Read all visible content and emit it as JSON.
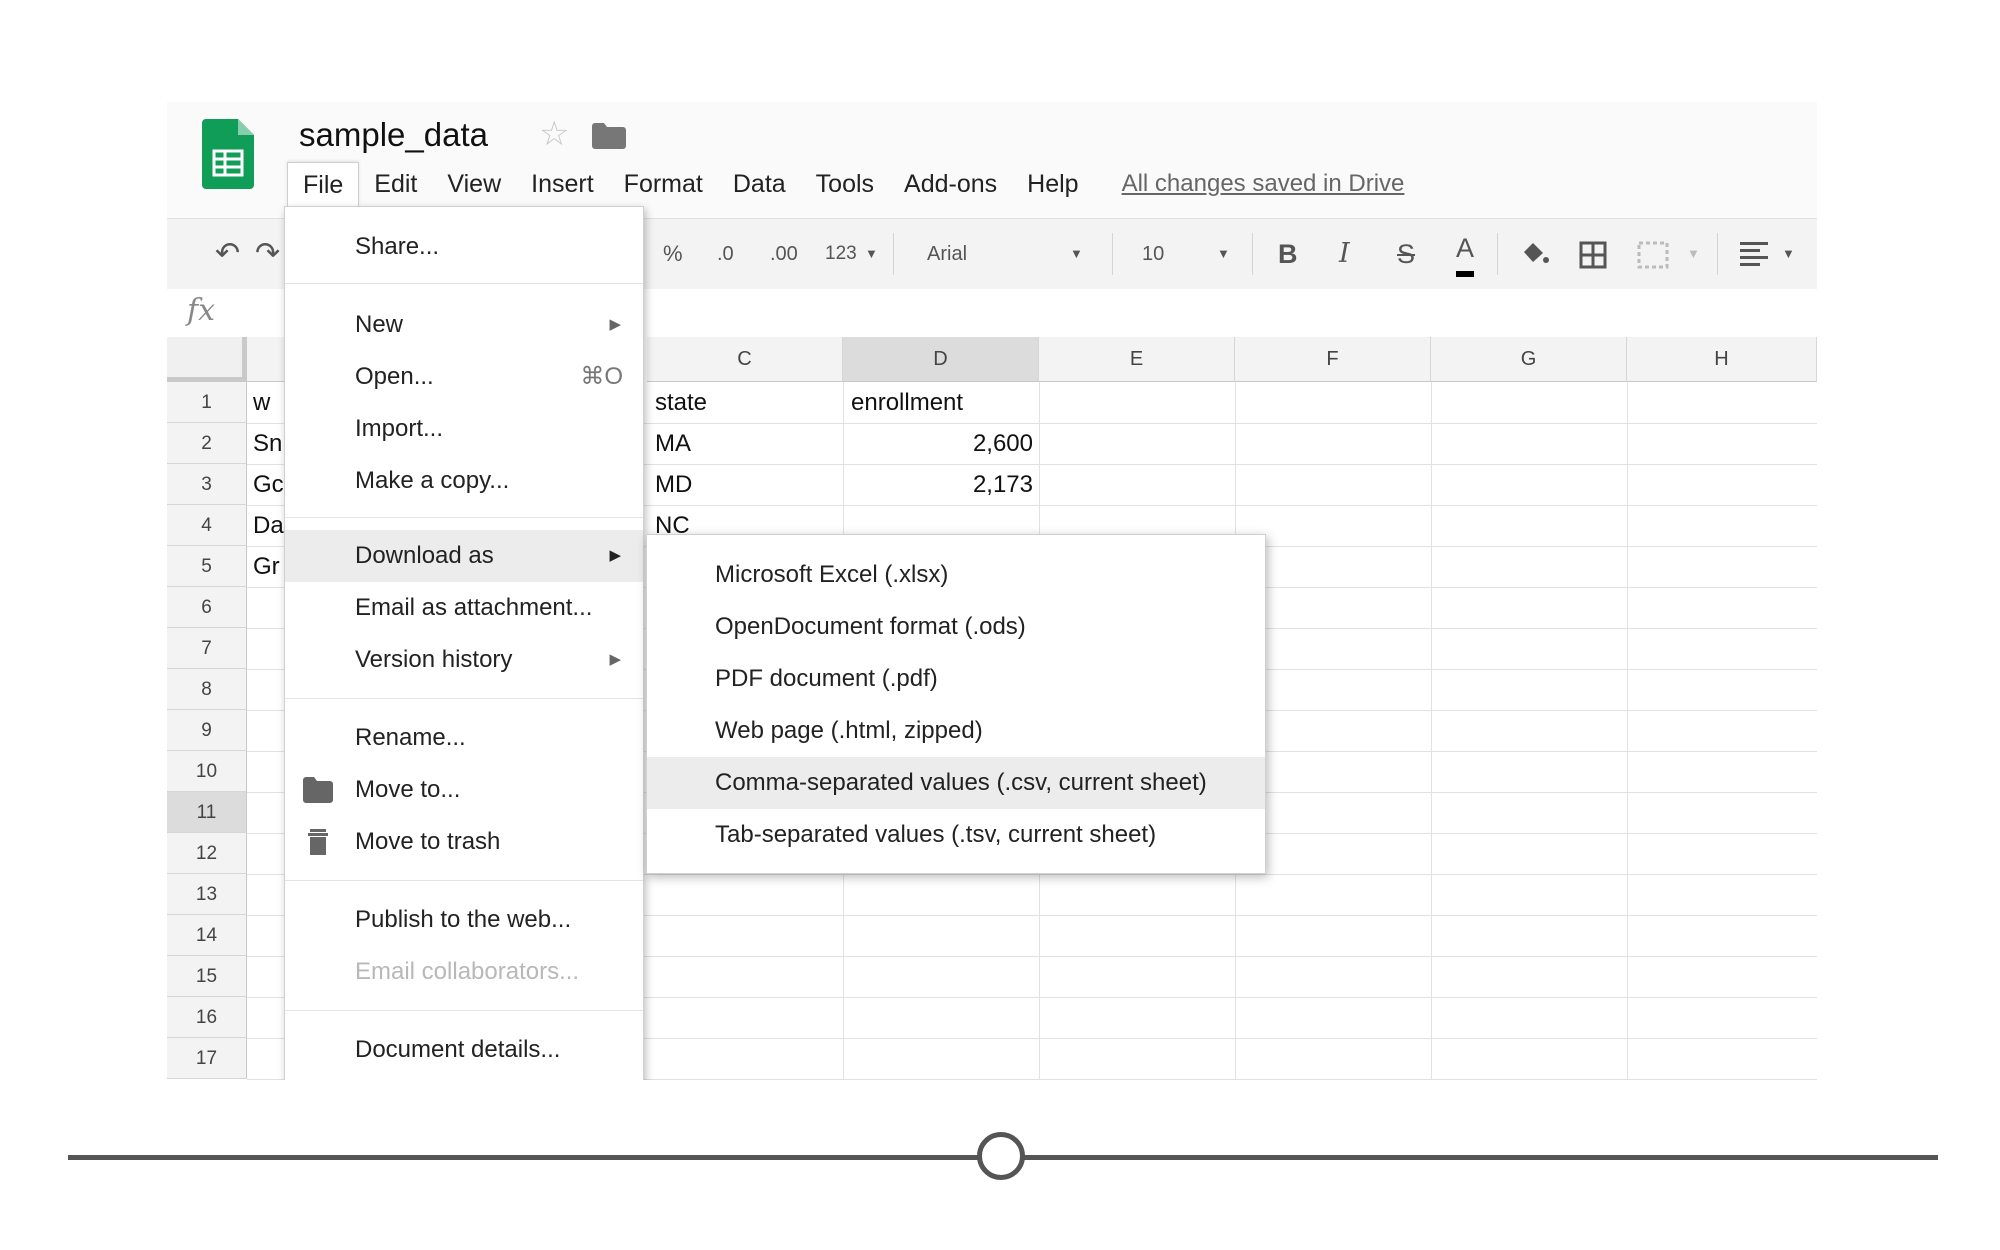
{
  "document": {
    "title": "sample_data",
    "status": "All changes saved in Drive"
  },
  "menubar": [
    "File",
    "Edit",
    "View",
    "Insert",
    "Format",
    "Data",
    "Tools",
    "Add-ons",
    "Help"
  ],
  "toolbar": {
    "percent": "%",
    "dec_decrease": ".0",
    "dec_increase": ".00",
    "more_formats": "123",
    "font": "Arial",
    "font_size": "10",
    "bold": "B",
    "italic": "I",
    "strike": "S",
    "text_color": "A"
  },
  "formula_bar": {
    "fx": "fx"
  },
  "grid": {
    "columns": [
      "C",
      "D",
      "E",
      "F",
      "G",
      "H"
    ],
    "selected_column": "D",
    "rows": [
      "1",
      "2",
      "3",
      "4",
      "5",
      "6",
      "7",
      "8",
      "9",
      "10",
      "11",
      "12",
      "13",
      "14",
      "15",
      "16",
      "17"
    ],
    "selected_row": "11",
    "col_b_partial": [
      "w",
      "Sn",
      "Gc",
      "Da",
      "Gr"
    ],
    "col_c": [
      "state",
      "MA",
      "MD",
      "NC"
    ],
    "col_d": [
      "enrollment",
      "2,600",
      "2,173"
    ]
  },
  "file_menu": {
    "share": "Share...",
    "new": "New",
    "open": "Open...",
    "open_shortcut": "⌘O",
    "import": "Import...",
    "make_copy": "Make a copy...",
    "download_as": "Download as",
    "email_attachment": "Email as attachment...",
    "version_history": "Version history",
    "rename": "Rename...",
    "move_to": "Move to...",
    "move_to_trash": "Move to trash",
    "publish": "Publish to the web...",
    "email_collaborators": "Email collaborators...",
    "document_details": "Document details..."
  },
  "download_submenu": [
    "Microsoft Excel (.xlsx)",
    "OpenDocument format (.ods)",
    "PDF document (.pdf)",
    "Web page (.html, zipped)",
    "Comma-separated values (.csv, current sheet)",
    "Tab-separated values (.tsv, current sheet)"
  ],
  "highlighted_submenu_item": "Comma-separated values (.csv, current sheet)",
  "slider": {
    "position_fraction": 0.5
  },
  "colors": {
    "sheets_green": "#0f9d58",
    "highlight": "#ececec",
    "header_bg": "#f3f3f3"
  }
}
